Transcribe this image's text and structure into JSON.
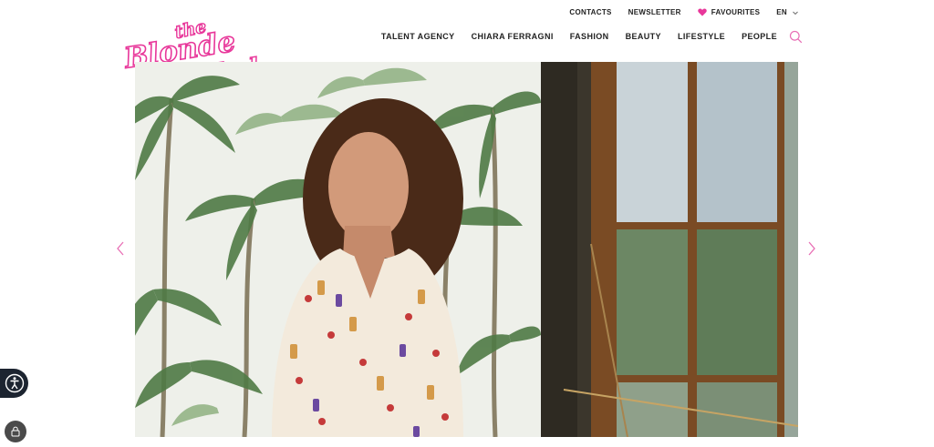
{
  "utility_nav": {
    "contacts": "CONTACTS",
    "newsletter": "NEWSLETTER",
    "favourites": "FAVOURITES",
    "language": "EN"
  },
  "brand": {
    "logo_line1": "the",
    "logo_line2": "Blonde",
    "logo_line3": "Salad",
    "accent_color": "#e8379a"
  },
  "main_nav": {
    "items": [
      {
        "label": "TALENT AGENCY"
      },
      {
        "label": "CHIARA FERRAGNI"
      },
      {
        "label": "FASHION"
      },
      {
        "label": "BEAUTY"
      },
      {
        "label": "LIFESTYLE"
      },
      {
        "label": "PEOPLE"
      }
    ]
  },
  "icons": {
    "search": "search-icon",
    "favourite": "heart-icon",
    "language_toggle": "chevron-down-icon",
    "prev": "chevron-left-icon",
    "next": "chevron-right-icon",
    "accessibility": "accessibility-icon",
    "privacy": "lock-icon"
  }
}
